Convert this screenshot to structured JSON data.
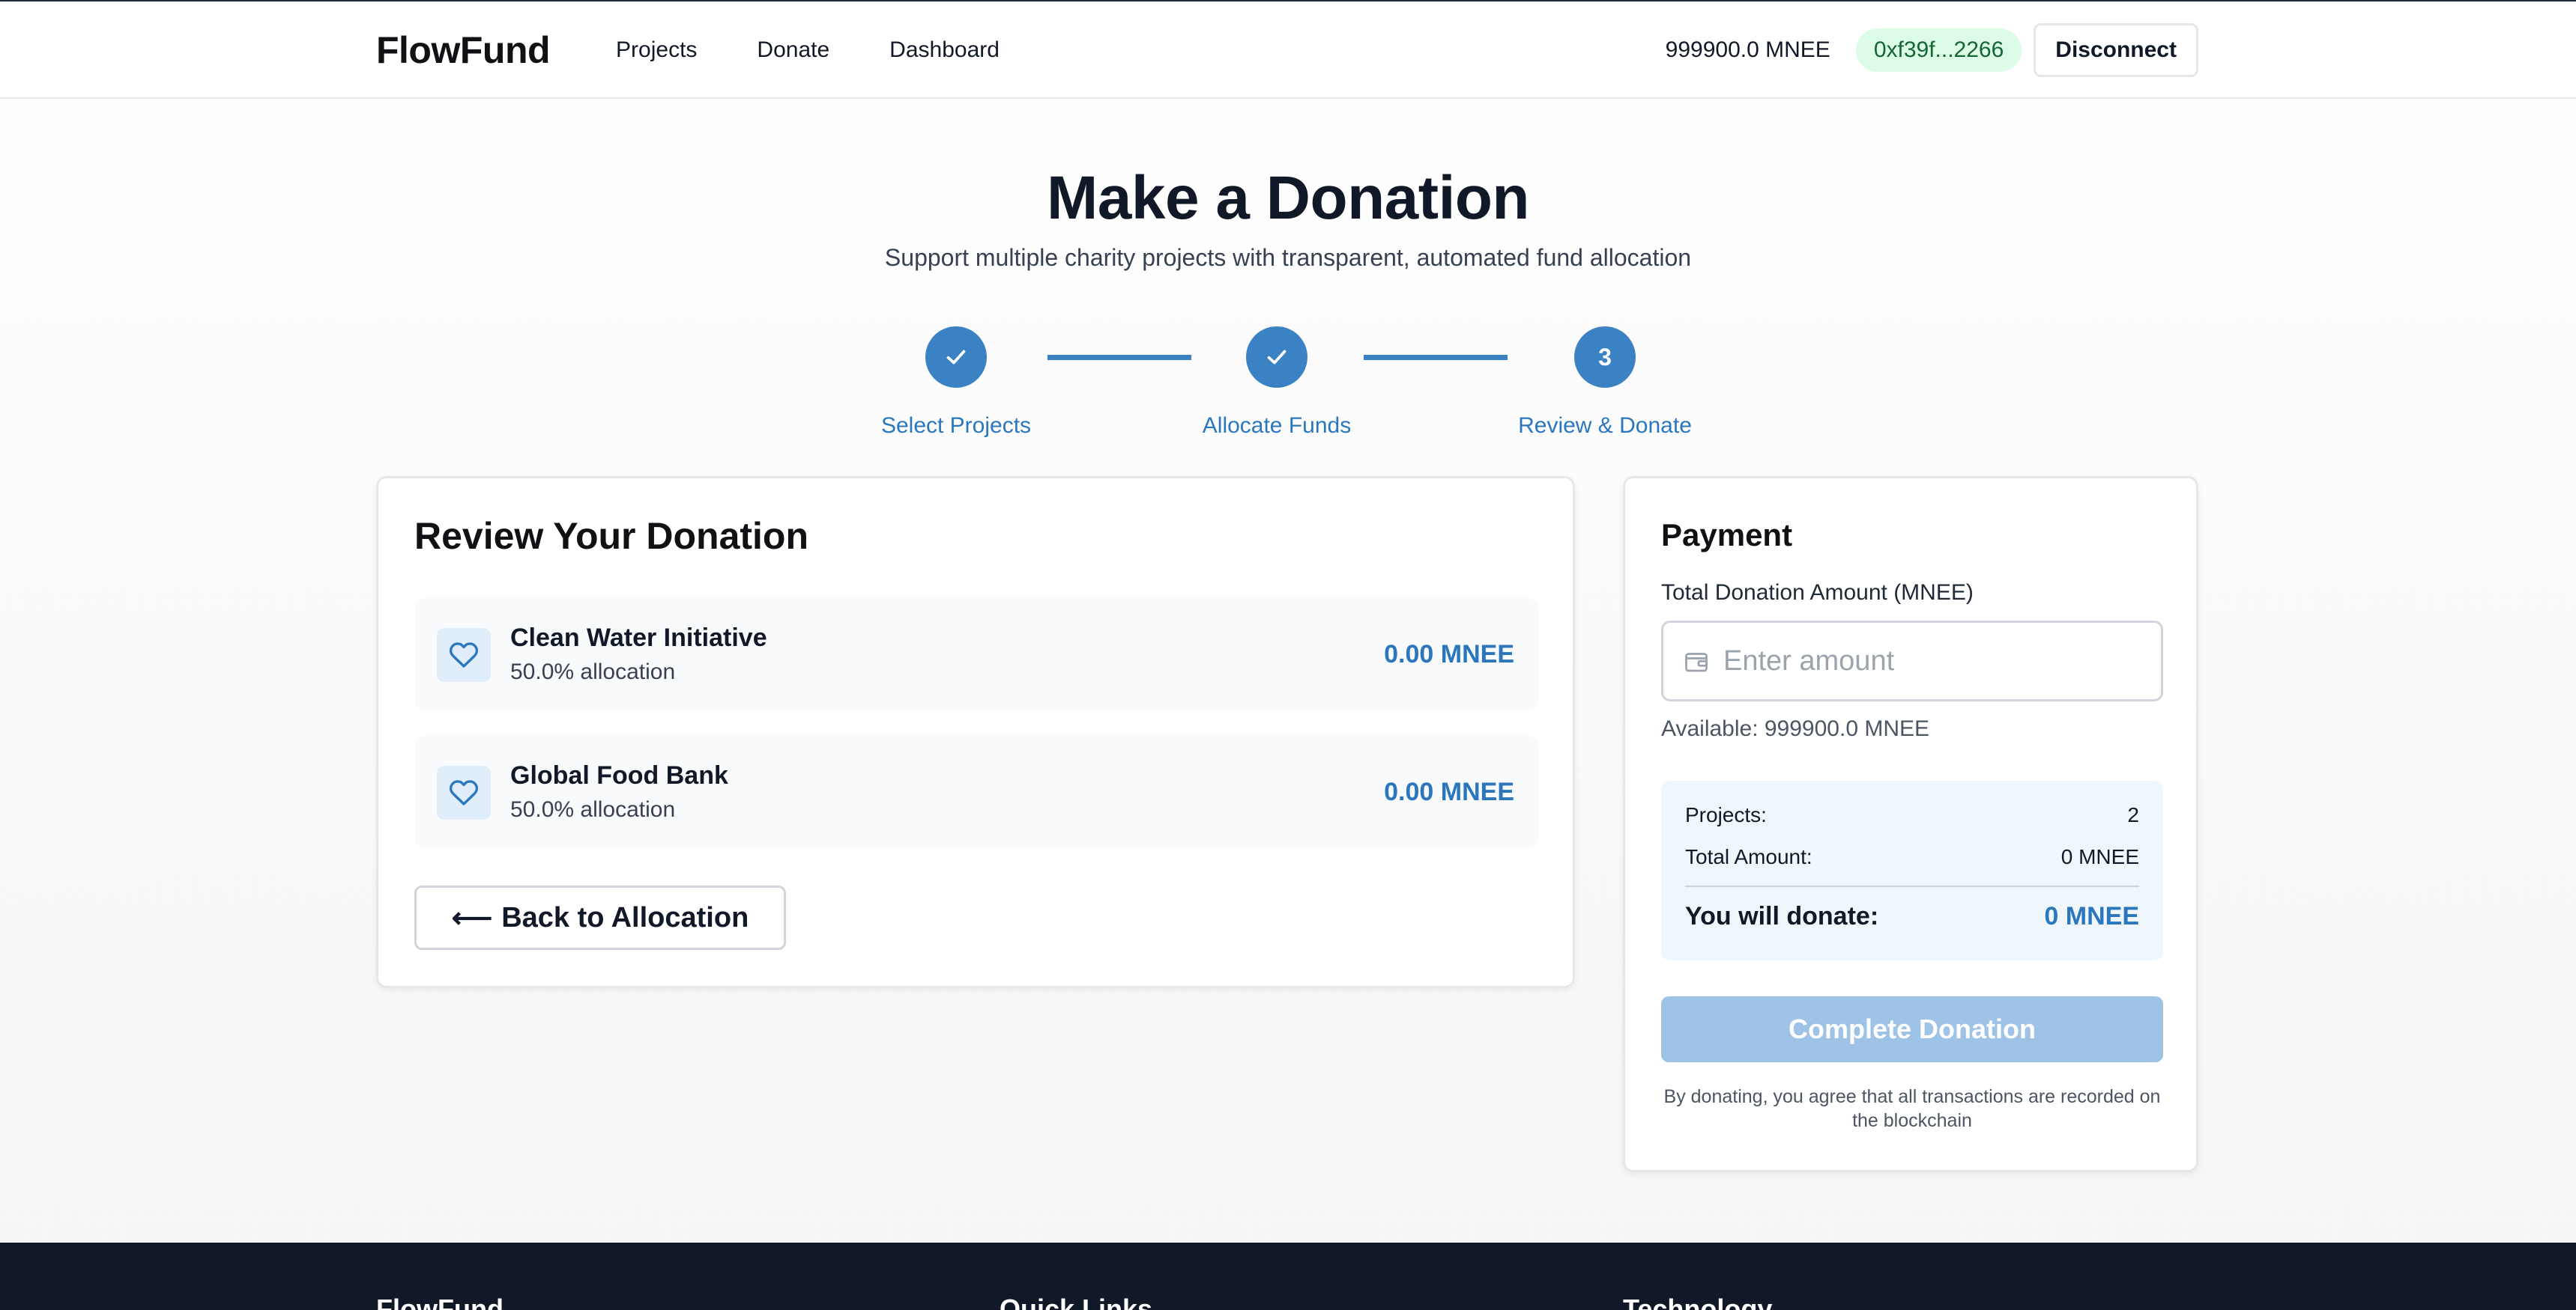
{
  "nav": {
    "brand": "FlowFund",
    "links": [
      "Projects",
      "Donate",
      "Dashboard"
    ],
    "balance": "999900.0 MNEE",
    "address": "0xf39f...2266",
    "disconnect_label": "Disconnect"
  },
  "page": {
    "title": "Make a Donation",
    "subtitle": "Support multiple charity projects with transparent, automated fund allocation"
  },
  "stepper": {
    "steps": [
      {
        "label": "Select Projects",
        "state": "complete",
        "icon": "check-icon"
      },
      {
        "label": "Allocate Funds",
        "state": "complete",
        "icon": "check-icon"
      },
      {
        "label": "Review & Donate",
        "state": "active",
        "number": "3"
      }
    ],
    "color": "#3b82c4"
  },
  "review": {
    "title": "Review Your Donation",
    "projects": [
      {
        "name": "Clean Water Initiative",
        "allocation": "50.0% allocation",
        "amount": "0.00 MNEE",
        "icon": "heart-icon"
      },
      {
        "name": "Global Food Bank",
        "allocation": "50.0% allocation",
        "amount": "0.00 MNEE",
        "icon": "heart-icon"
      }
    ],
    "back_label": "Back to Allocation",
    "back_arrow": "⟵"
  },
  "payment": {
    "title": "Payment",
    "amount_label": "Total Donation Amount (MNEE)",
    "amount_placeholder": "Enter amount",
    "amount_value": "",
    "available": "Available: 999900.0 MNEE",
    "summary": {
      "projects_label": "Projects:",
      "projects_value": "2",
      "total_label": "Total Amount:",
      "total_value": "0 MNEE",
      "donate_label": "You will donate:",
      "donate_value": "0 MNEE"
    },
    "complete_label": "Complete Donation",
    "disclaimer": "By donating, you agree that all transactions are recorded on the blockchain"
  },
  "footer": {
    "columns": [
      "FlowFund",
      "Quick Links",
      "Technology"
    ]
  },
  "colors": {
    "accent": "#3b82c4",
    "accent_text": "#2b77bd",
    "address_badge_bg": "#dcfce7",
    "button_disabled": "#9ec3e6",
    "footer_bg": "#111827"
  }
}
